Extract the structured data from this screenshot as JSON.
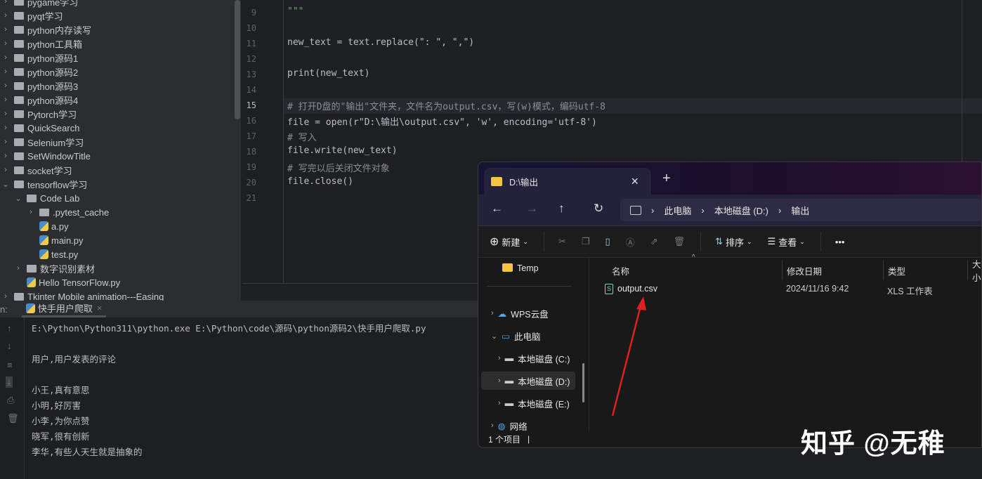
{
  "project_tree": {
    "items": [
      {
        "label": "pygame学习",
        "type": "folder",
        "depth": 0,
        "expanded": false
      },
      {
        "label": "pyqt学习",
        "type": "folder",
        "depth": 0,
        "expanded": false
      },
      {
        "label": "python内存读写",
        "type": "folder",
        "depth": 0,
        "expanded": false
      },
      {
        "label": "python工具箱",
        "type": "folder",
        "depth": 0,
        "expanded": false
      },
      {
        "label": "python源码1",
        "type": "folder",
        "depth": 0,
        "expanded": false
      },
      {
        "label": "python源码2",
        "type": "folder",
        "depth": 0,
        "expanded": false
      },
      {
        "label": "python源码3",
        "type": "folder",
        "depth": 0,
        "expanded": false
      },
      {
        "label": "python源码4",
        "type": "folder",
        "depth": 0,
        "expanded": false
      },
      {
        "label": "Pytorch学习",
        "type": "folder",
        "depth": 0,
        "expanded": false
      },
      {
        "label": "QuickSearch",
        "type": "folder",
        "depth": 0,
        "expanded": false
      },
      {
        "label": "Selenium学习",
        "type": "folder",
        "depth": 0,
        "expanded": false
      },
      {
        "label": "SetWindowTitle",
        "type": "folder",
        "depth": 0,
        "expanded": false
      },
      {
        "label": "socket学习",
        "type": "folder",
        "depth": 0,
        "expanded": false
      },
      {
        "label": "tensorflow学习",
        "type": "folder",
        "depth": 0,
        "expanded": true
      },
      {
        "label": "Code Lab",
        "type": "folder",
        "depth": 1,
        "expanded": true
      },
      {
        "label": ".pytest_cache",
        "type": "folder",
        "depth": 2,
        "expanded": false
      },
      {
        "label": "a.py",
        "type": "py",
        "depth": 2
      },
      {
        "label": "main.py",
        "type": "py",
        "depth": 2
      },
      {
        "label": "test.py",
        "type": "py",
        "depth": 2
      },
      {
        "label": "数字识别素材",
        "type": "folder",
        "depth": 1,
        "expanded": false
      },
      {
        "label": "Hello TensorFlow.py",
        "type": "py",
        "depth": 1
      },
      {
        "label": "Tkinter Mobile animation---Easing",
        "type": "folder",
        "depth": 0,
        "expanded": false
      }
    ]
  },
  "editor": {
    "current_line": "15",
    "lines": [
      {
        "n": "9",
        "t": "\"\"\""
      },
      {
        "n": "10",
        "t": ""
      },
      {
        "n": "11",
        "t": "new_text = text.replace(\": \", \",\")"
      },
      {
        "n": "12",
        "t": ""
      },
      {
        "n": "13",
        "t": "print(new_text)"
      },
      {
        "n": "14",
        "t": ""
      },
      {
        "n": "15",
        "t": "# 打开D盘的\"输出\"文件夹，文件名为output.csv，写(w)模式，编码utf-8"
      },
      {
        "n": "16",
        "t": "file = open(r\"D:\\输出\\output.csv\", 'w', encoding='utf-8')"
      },
      {
        "n": "17",
        "t": "# 写入"
      },
      {
        "n": "18",
        "t": "file.write(new_text)"
      },
      {
        "n": "19",
        "t": "# 写完以后关闭文件对象"
      },
      {
        "n": "20",
        "t": "file.close()"
      },
      {
        "n": "21",
        "t": ""
      }
    ]
  },
  "run_panel": {
    "label": "n:",
    "tab": "快手用户爬取",
    "output": [
      "E:\\Python\\Python311\\python.exe E:\\Python\\code\\源码\\python源码2\\快手用户爬取.py",
      "",
      "用户,用户发表的评论",
      "",
      "小王,真有意思",
      "小明,好厉害",
      "小李,为你点赞",
      "晓军,很有创新",
      "李华,有些人天生就是抽象的"
    ]
  },
  "explorer": {
    "tab_title": "D:\\输出",
    "breadcrumb": [
      "此电脑",
      "本地磁盘 (D:)",
      "输出"
    ],
    "toolbar": {
      "new": "新建",
      "sort": "排序",
      "view": "查看",
      "more": "•••"
    },
    "nav": [
      {
        "label": "Temp",
        "icon": "folder"
      },
      {
        "label": "WPS云盘",
        "icon": "cloud"
      },
      {
        "label": "此电脑",
        "icon": "pc"
      },
      {
        "label": "本地磁盘 (C:)",
        "icon": "drive"
      },
      {
        "label": "本地磁盘 (D:)",
        "icon": "drive",
        "selected": true
      },
      {
        "label": "本地磁盘 (E:)",
        "icon": "drive"
      },
      {
        "label": "网络",
        "icon": "network"
      }
    ],
    "columns": [
      "名称",
      "修改日期",
      "类型",
      "大小"
    ],
    "files": [
      {
        "name": "output.csv",
        "modified": "2024/11/16 9:42",
        "type": "XLS 工作表"
      }
    ],
    "status": "1 个项目"
  },
  "watermark": "知乎 @无稚",
  "colors": {
    "annotation_arrow": "#e02020"
  }
}
